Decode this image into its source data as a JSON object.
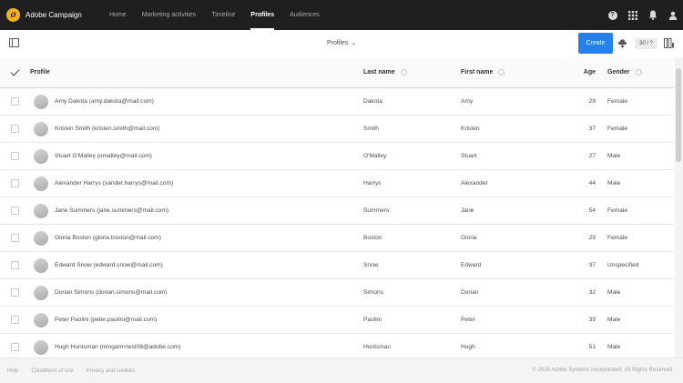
{
  "app": {
    "brand": "Adobe Campaign",
    "logo_glyph": "Ø"
  },
  "nav": {
    "tabs": [
      {
        "label": "Home"
      },
      {
        "label": "Marketing activities"
      },
      {
        "label": "Timeline"
      },
      {
        "label": "Profiles",
        "active": true
      },
      {
        "label": "Audiences"
      }
    ],
    "help_glyph": "?"
  },
  "toolbar": {
    "view_title": "Profiles",
    "chevron": "⌄",
    "create_label": "Create",
    "count": "30 / ?"
  },
  "table": {
    "headers": {
      "profile": "Profile",
      "last_name": "Last name",
      "first_name": "First name",
      "age": "Age",
      "gender": "Gender"
    },
    "rows": [
      {
        "profile": "Amy Dakota (amy.dakota@mail.com)",
        "last_name": "Dakota",
        "first_name": "Amy",
        "age": "28",
        "gender": "Female"
      },
      {
        "profile": "Kristen Smith (kristen.smith@mail.com)",
        "last_name": "Smith",
        "first_name": "Kristen",
        "age": "37",
        "gender": "Female"
      },
      {
        "profile": "Stuart O'Malley (omalley@mail.com)",
        "last_name": "O'Malley",
        "first_name": "Stuart",
        "age": "27",
        "gender": "Male"
      },
      {
        "profile": "Alexander Harrys (xander.harrys@mail.com)",
        "last_name": "Harrys",
        "first_name": "Alexander",
        "age": "44",
        "gender": "Male"
      },
      {
        "profile": "Jane Summers (jane.summers@mail.com)",
        "last_name": "Summers",
        "first_name": "Jane",
        "age": "54",
        "gender": "Female"
      },
      {
        "profile": "Gloria Boston (gloria.boston@mail.com)",
        "last_name": "Boston",
        "first_name": "Gloria",
        "age": "29",
        "gender": "Female"
      },
      {
        "profile": "Edward Snow (edward.snow@mail.com)",
        "last_name": "Snow",
        "first_name": "Edward",
        "age": "37",
        "gender": "Unspecified"
      },
      {
        "profile": "Dorian Simons (dorian.simons@mail.com)",
        "last_name": "Simons",
        "first_name": "Dorian",
        "age": "32",
        "gender": "Male"
      },
      {
        "profile": "Peter Paolini (peter.paolini@mail.com)",
        "last_name": "Paolini",
        "first_name": "Peter",
        "age": "39",
        "gender": "Male"
      },
      {
        "profile": "Hugh Huntsman (mingam+test08@adobe.com)",
        "last_name": "Huntsman",
        "first_name": "Hugh",
        "age": "51",
        "gender": "Male"
      }
    ]
  },
  "footer": {
    "links": [
      {
        "label": "Help"
      },
      {
        "label": "Conditions of use"
      },
      {
        "label": "Privacy and cookies"
      }
    ],
    "copyright": "© 2016 Adobe Systems Incorporated. All Rights Reserved."
  },
  "colors": {
    "topbar": "#1f1f1f",
    "accent": "#2680eb",
    "logo": "#f5b21b"
  }
}
